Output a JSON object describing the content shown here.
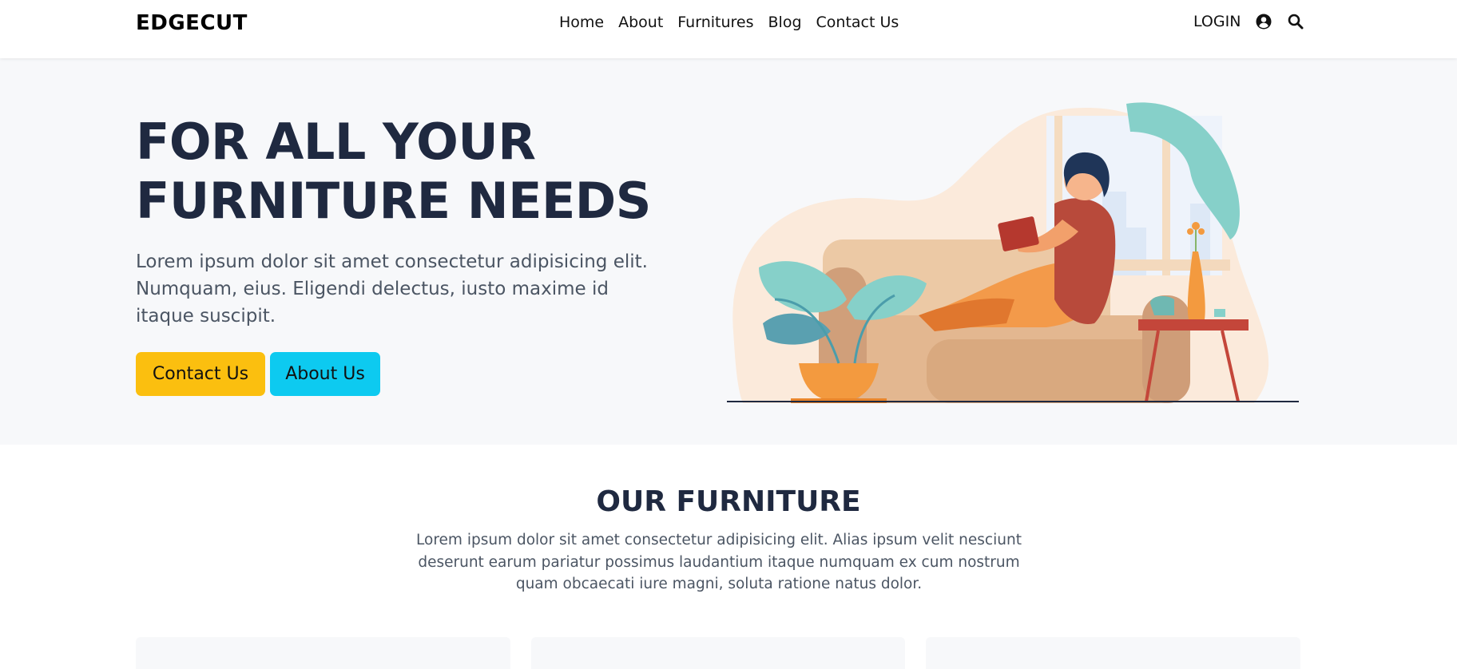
{
  "brand": {
    "name": "EDGECUT"
  },
  "nav": {
    "links": [
      "Home",
      "About",
      "Furnitures",
      "Blog",
      "Contact Us"
    ],
    "login": "LOGIN",
    "icons": [
      "user-circle-icon",
      "search-icon"
    ]
  },
  "hero": {
    "title_line1": "FOR ALL YOUR",
    "title_line2": "FURNITURE NEEDS",
    "text": "Lorem ipsum dolor sit amet consectetur adipisicing elit. Numquam, eius. Eligendi delectus, iusto maxime id itaque suscipit.",
    "contact_button": "Contact Us",
    "about_button": "About Us"
  },
  "furniture": {
    "title": "OUR FURNITURE",
    "text": "Lorem ipsum dolor sit amet consectetur adipisicing elit. Alias ipsum velit nesciunt deserunt earum pariatur possimus laudantium itaque numquam ex cum nostrum quam obcaecati iure magni, soluta ratione natus dolor."
  },
  "colors": {
    "accent_yellow": "#fbbf0f",
    "accent_cyan": "#0dcaf0",
    "heading": "#1f2940",
    "hero_bg": "#f7f8fa"
  }
}
